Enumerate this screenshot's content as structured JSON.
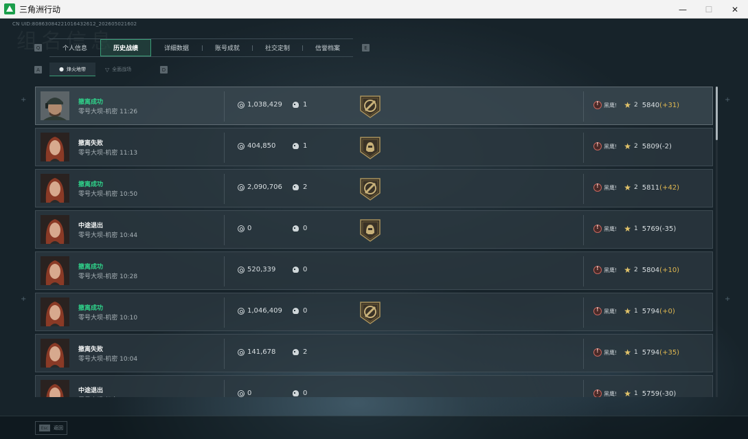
{
  "window": {
    "title": "三角洲行动",
    "minimize_glyph": "—",
    "maximize_glyph": "☐",
    "close_glyph": "✕"
  },
  "uid_text": "CN UID:80863084221016432612_202605021602",
  "watermark_text": "组名信息",
  "tabs": {
    "prev_key": "Q",
    "next_key": "E",
    "items": [
      {
        "label": "个人信息",
        "active": false
      },
      {
        "label": "历史战绩",
        "active": true
      },
      {
        "label": "详细数据",
        "active": false
      },
      {
        "label": "账号成就",
        "active": false
      },
      {
        "label": "社交定制",
        "active": false
      },
      {
        "label": "信誉档案",
        "active": false
      }
    ]
  },
  "subtabs": {
    "prev_key": "A",
    "next_key": "D",
    "items": [
      {
        "label": "烽火地带",
        "icon": "user-icon",
        "active": true
      },
      {
        "label": "全面战场",
        "icon": "triangle-icon",
        "active": false
      }
    ]
  },
  "matches": [
    {
      "status": "撤离成功",
      "success": true,
      "map": "零号大坝-机密",
      "time": "11:26",
      "money": "1,038,429",
      "kills": "1",
      "medal": "medal-diagonal",
      "operator": "黑鹰",
      "rank_level": "2",
      "score": "5840",
      "delta": "(+31)",
      "delta_positive": true,
      "avatar": "male-soldier",
      "highlight": true
    },
    {
      "status": "撤离失败",
      "success": false,
      "map": "零号大坝-机密",
      "time": "11:13",
      "money": "404,850",
      "kills": "1",
      "medal": "medal-helmet",
      "operator": "黑鹰",
      "rank_level": "2",
      "score": "5809",
      "delta": "(-2)",
      "delta_positive": false,
      "avatar": "female-red-hair",
      "highlight": false
    },
    {
      "status": "撤离成功",
      "success": true,
      "map": "零号大坝-机密",
      "time": "10:50",
      "money": "2,090,706",
      "kills": "2",
      "medal": "medal-diagonal",
      "operator": "黑鹰",
      "rank_level": "2",
      "score": "5811",
      "delta": "(+42)",
      "delta_positive": true,
      "avatar": "female-red-hair",
      "highlight": false
    },
    {
      "status": "中途退出",
      "success": false,
      "map": "零号大坝-机密",
      "time": "10:44",
      "money": "0",
      "kills": "0",
      "medal": "medal-helmet",
      "operator": "黑鹰",
      "rank_level": "1",
      "score": "5769",
      "delta": "(-35)",
      "delta_positive": false,
      "avatar": "female-red-hair",
      "highlight": false
    },
    {
      "status": "撤离成功",
      "success": true,
      "map": "零号大坝-机密",
      "time": "10:28",
      "money": "520,339",
      "kills": "0",
      "medal": "",
      "operator": "黑鹰",
      "rank_level": "2",
      "score": "5804",
      "delta": "(+10)",
      "delta_positive": true,
      "avatar": "female-red-hair",
      "highlight": false
    },
    {
      "status": "撤离成功",
      "success": true,
      "map": "零号大坝-机密",
      "time": "10:10",
      "money": "1,046,409",
      "kills": "0",
      "medal": "medal-diagonal",
      "operator": "黑鹰",
      "rank_level": "1",
      "score": "5794",
      "delta": "(+0)",
      "delta_positive": true,
      "avatar": "female-red-hair",
      "highlight": false
    },
    {
      "status": "撤离失败",
      "success": false,
      "map": "零号大坝-机密",
      "time": "10:04",
      "money": "141,678",
      "kills": "2",
      "medal": "",
      "operator": "黑鹰",
      "rank_level": "1",
      "score": "5794",
      "delta": "(+35)",
      "delta_positive": true,
      "avatar": "female-red-hair",
      "highlight": false
    },
    {
      "status": "中途退出",
      "success": false,
      "map": "零号大坝-机密",
      "time": "09:53",
      "money": "0",
      "kills": "0",
      "medal": "",
      "operator": "黑鹰",
      "rank_level": "1",
      "score": "5759",
      "delta": "(-30)",
      "delta_positive": false,
      "avatar": "female-red-hair",
      "highlight": false
    }
  ],
  "bottom": {
    "esc_key": "Esc",
    "back_label": "返回"
  },
  "colors": {
    "success": "#2fd28a",
    "positive_delta": "#e0b851",
    "tab_active_border": "#3b9e78"
  }
}
